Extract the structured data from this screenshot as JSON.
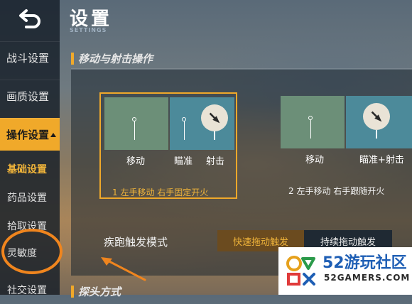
{
  "header": {
    "title": "设置",
    "subtitle": "SETTINGS"
  },
  "sidebar": {
    "items": [
      {
        "label": "战斗设置"
      },
      {
        "label": "画质设置"
      },
      {
        "label": "操作设置"
      }
    ],
    "sub_items": [
      {
        "label": "基础设置"
      },
      {
        "label": "药品设置"
      },
      {
        "label": "拾取设置"
      },
      {
        "label": "灵敏度"
      },
      {
        "label": "社交设置"
      }
    ]
  },
  "section1": {
    "title": "移动与射击操作"
  },
  "section2": {
    "title": "探头方式"
  },
  "options": [
    {
      "move_label": "移动",
      "aim_label": "瞄准",
      "fire_label": "射击",
      "caption": "1 左手移动 右手固定开火"
    },
    {
      "move_label": "移动",
      "aim_fire_label": "瞄准+射击",
      "caption": "2 左手移动 右手跟随开火"
    }
  ],
  "sprint": {
    "label": "疾跑触发模式",
    "option_on": "快速拖动触发",
    "option_off": "持续拖动触发"
  },
  "watermark": {
    "title": "52游玩社区",
    "url": "52GAMERS.COM"
  },
  "colors": {
    "accent": "#f0a92a",
    "annotation": "#f0851e",
    "move_zone": "#6c8f78",
    "aim_zone": "#4c8a9a"
  }
}
